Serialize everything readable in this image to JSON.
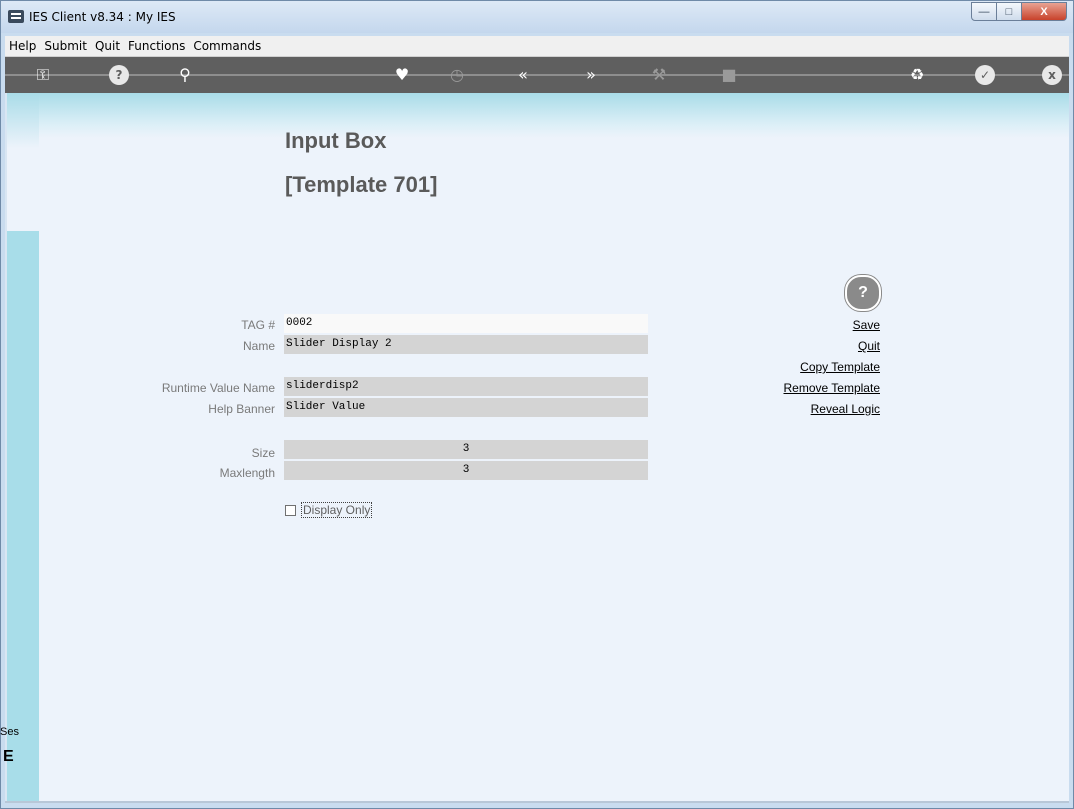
{
  "window": {
    "title": "IES Client v8.34 : My IES",
    "minimize_icon": "minimize-icon",
    "maximize_icon": "maximize-icon",
    "close_label": "X"
  },
  "menubar": {
    "items": [
      "Help",
      "Submit",
      "Quit",
      "Functions",
      "Commands"
    ]
  },
  "toolbar": {
    "icons": [
      "key-icon",
      "help-icon",
      "search-icon",
      "heart-icon",
      "clock-icon",
      "rewind-icon",
      "forward-icon",
      "tools-icon",
      "square-icon",
      "recycle-icon",
      "check-icon",
      "close-icon"
    ],
    "help_glyph": "?",
    "close_glyph": "x"
  },
  "page": {
    "title": "Input Box",
    "subtitle": "[Template 701]"
  },
  "form": {
    "tag_label": "TAG #",
    "tag_value": "0002",
    "name_label": "Name",
    "name_value": "Slider Display 2",
    "runtime_label": "Runtime Value Name",
    "runtime_value": "sliderdisp2",
    "help_banner_label": "Help Banner",
    "help_banner_value": "Slider Value",
    "size_label": "Size",
    "size_value": "3",
    "maxlength_label": "Maxlength",
    "maxlength_value": "3",
    "display_only_label": "Display Only",
    "display_only_checked": false
  },
  "actions": {
    "help_glyph": "?",
    "save": "Save",
    "quit": "Quit",
    "copy_template": "Copy Template",
    "remove_template": "Remove Template",
    "reveal_logic": "Reveal Logic"
  },
  "sidebar": {
    "session_label": "Ses",
    "session_glyph": "E"
  }
}
